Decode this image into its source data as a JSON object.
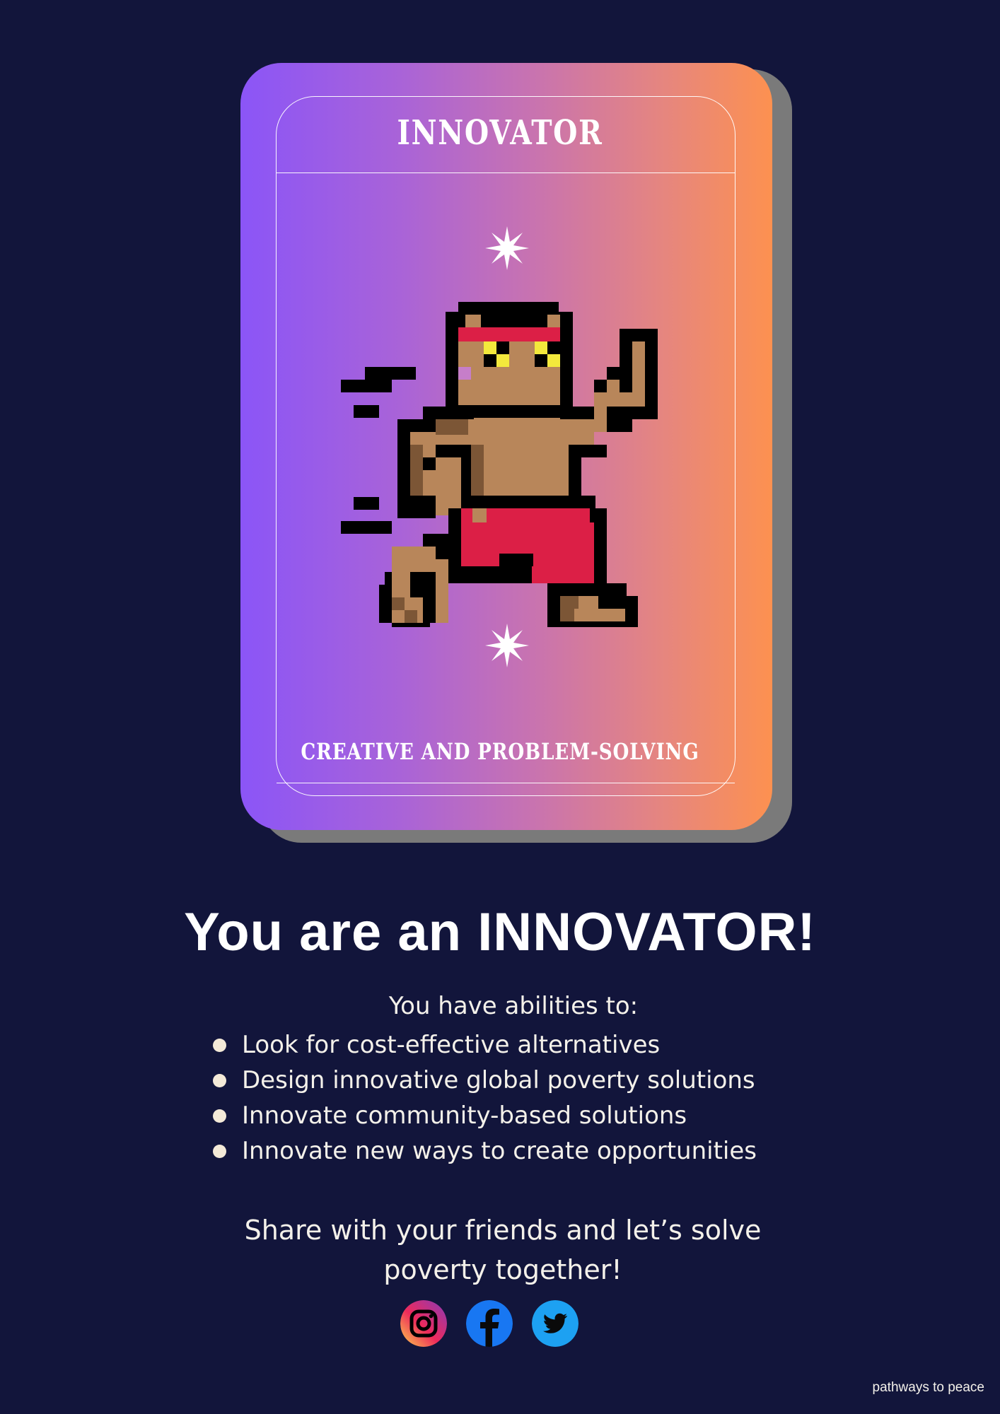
{
  "card": {
    "title": "INNOVATOR",
    "subtitle": "CREATIVE AND PROBLEM-SOLVING",
    "colors": {
      "gradient_start": "#8b55f7",
      "gradient_end": "#fd9150",
      "shadow": "#7a7a7a"
    },
    "icons": [
      "sparkle-icon",
      "pixel-fighter-character",
      "sparkle-icon"
    ]
  },
  "result": {
    "headline": "You are an INNOVATOR!",
    "intro": "You have abilities to:",
    "abilities": [
      "Look for cost-effective alternatives",
      "Design innovative global poverty solutions",
      "Innovate community-based solutions",
      "Innovate new ways to create opportunities"
    ]
  },
  "share": {
    "line1": "Share with your friends and let’s solve",
    "line2": "poverty together!",
    "icons": [
      "instagram-icon",
      "facebook-icon",
      "twitter-icon"
    ]
  },
  "footer": {
    "brand": "pathways to peace"
  },
  "colors": {
    "background": "#12153b",
    "text": "#f4f1ea",
    "headband": "#dc1f46",
    "skin": "#b8865a"
  }
}
